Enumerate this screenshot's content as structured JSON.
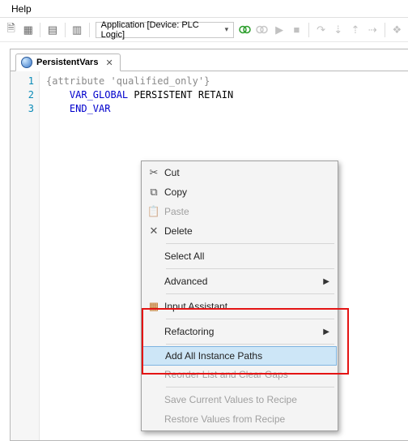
{
  "menubar": {
    "help": "Help"
  },
  "toolbar": {
    "app_label": "Application [Device: PLC Logic]"
  },
  "tab": {
    "title": "PersistentVars"
  },
  "code": {
    "lines": [
      "1",
      "2",
      "3"
    ],
    "l1": "{attribute 'qualified_only'}",
    "l2a": "VAR_GLOBAL",
    "l2b": " PERSISTENT RETAIN",
    "l3": "END_VAR"
  },
  "context_menu": {
    "cut": "Cut",
    "copy": "Copy",
    "paste": "Paste",
    "delete": "Delete",
    "select_all": "Select All",
    "advanced": "Advanced",
    "input_assistant": "Input Assistant...",
    "refactoring": "Refactoring",
    "add_all_instance_paths": "Add All Instance Paths",
    "reorder": "Reorder List and Clear Gaps",
    "save_recipe": "Save Current Values to Recipe",
    "restore_recipe": "Restore Values from Recipe"
  }
}
